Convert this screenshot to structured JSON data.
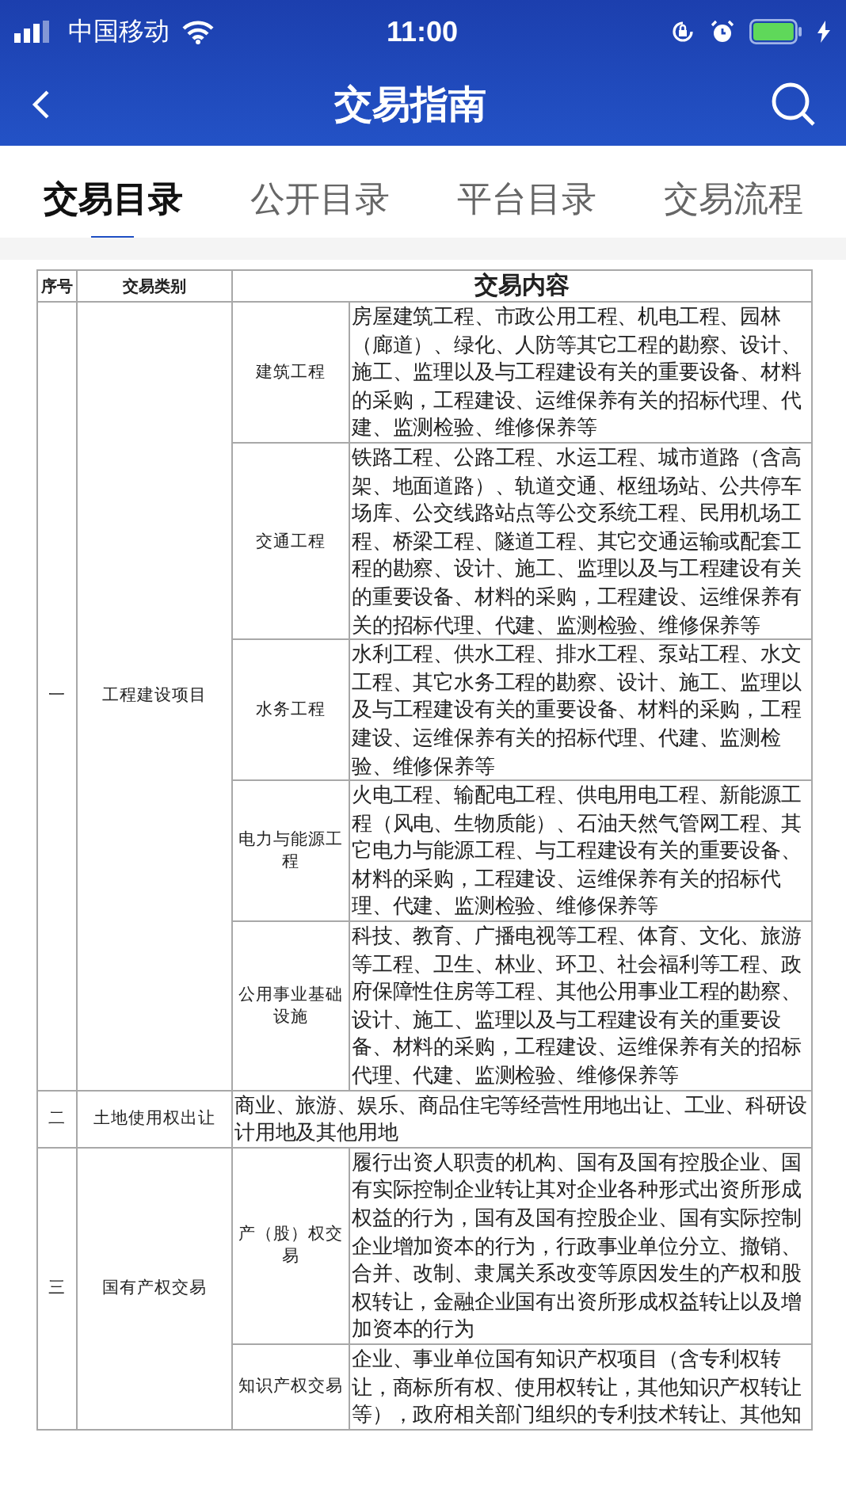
{
  "status_bar": {
    "carrier": "中国移动",
    "time": "11:00"
  },
  "nav": {
    "title": "交易指南"
  },
  "tabs": [
    {
      "label": "交易目录",
      "selected": true
    },
    {
      "label": "公开目录",
      "selected": false
    },
    {
      "label": "平台目录",
      "selected": false
    },
    {
      "label": "交易流程",
      "selected": false
    }
  ],
  "table": {
    "columns": [
      "序号",
      "交易类别",
      "交易内容"
    ],
    "rows": [
      {
        "kind": "split",
        "number": "一",
        "category": "工程建设项目",
        "items": [
          {
            "subcategory": "建筑工程",
            "content": "房屋建筑工程、市政公用工程、机电工程、园林（廊道）、绿化、人防等其它工程的勘察、设计、施工、监理以及与工程建设有关的重要设备、材料的采购，工程建设、运维保养有关的招标代理、代建、监测检验、维修保养等"
          },
          {
            "subcategory": "交通工程",
            "content": "铁路工程、公路工程、水运工程、城市道路（含高架、地面道路）、轨道交通、枢纽场站、公共停车场库、公交线路站点等公交系统工程、民用机场工程、桥梁工程、隧道工程、其它交通运输或配套工程的勘察、设计、施工、监理以及与工程建设有关的重要设备、材料的采购，工程建设、运维保养有关的招标代理、代建、监测检验、维修保养等"
          },
          {
            "subcategory": "水务工程",
            "content": "水利工程、供水工程、排水工程、泵站工程、水文工程、其它水务工程的勘察、设计、施工、监理以及与工程建设有关的重要设备、材料的采购，工程建设、运维保养有关的招标代理、代建、监测检验、维修保养等"
          },
          {
            "subcategory": "电力与能源工程",
            "content": "火电工程、输配电工程、供电用电工程、新能源工程（风电、生物质能）、石油天然气管网工程、其它电力与能源工程、与工程建设有关的重要设备、材料的采购，工程建设、运维保养有关的招标代理、代建、监测检验、维修保养等"
          },
          {
            "subcategory": "公用事业基础设施",
            "content": "科技、教育、广播电视等工程、体育、文化、旅游等工程、卫生、林业、环卫、社会福利等工程、政府保障性住房等工程、其他公用事业工程的勘察、设计、施工、监理以及与工程建设有关的重要设备、材料的采购，工程建设、运维保养有关的招标代理、代建、监测检验、维修保养等"
          }
        ]
      },
      {
        "kind": "whole",
        "number": "二",
        "category": "土地使用权出让",
        "content": "商业、旅游、娱乐、商品住宅等经营性用地出让、工业、科研设计用地及其他用地"
      },
      {
        "kind": "split",
        "number": "三",
        "category": "国有产权交易",
        "items": [
          {
            "subcategory": "产（股）权交易",
            "content": "履行出资人职责的机构、国有及国有控股企业、国有实际控制企业转让其对企业各种形式出资所形成权益的行为，国有及国有控股企业、国有实际控制企业增加资本的行为，行政事业单位分立、撤销、合并、改制、隶属关系改变等原因发生的产权和股权转让，金融企业国有出资所形成权益转让以及增加资本的行为"
          },
          {
            "subcategory": "知识产权交易",
            "content": "企业、事业单位国有知识产权项目（含专利权转让，商标所有权、使用权转让，其他知识产权转让等），政府相关部门组织的专利技术转让、其他知"
          }
        ]
      }
    ]
  }
}
